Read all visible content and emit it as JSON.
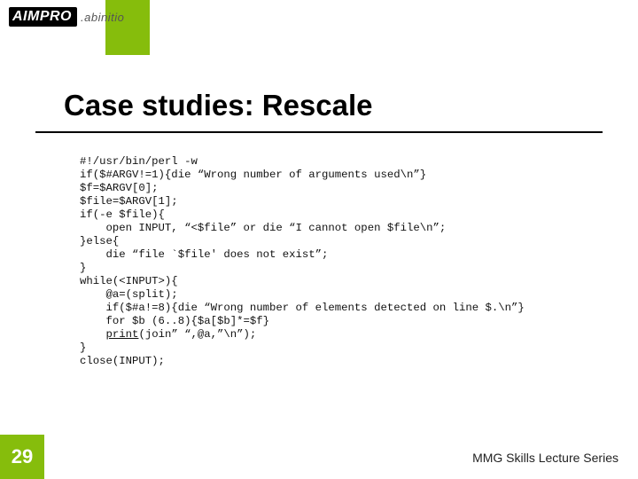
{
  "logo": {
    "main": "AIMPRO",
    "sub": ".abinitio"
  },
  "title": "Case studies: Rescale",
  "code": {
    "l1": "#!/usr/bin/perl -w",
    "l2": "if($#ARGV!=1){die “Wrong number of arguments used\\n”}",
    "l3": "$f=$ARGV[0];",
    "l4": "$file=$ARGV[1];",
    "l5": "if(-e $file){",
    "l6": "    open INPUT, “<$file” or die “I cannot open $file\\n”;",
    "l7": "}else{",
    "l8": "    die “file `$file' does not exist”;",
    "l9": "}",
    "l10": "while(<INPUT>){",
    "l11": "    @a=(split);",
    "l12": "    if($#a!=8){die “Wrong number of elements detected on line $.\\n”}",
    "l13": "    for $b (6..8){$a[$b]*=$f}",
    "l14a": "    ",
    "l14b": "print",
    "l14c": "(join” “,@a,”\\n”);",
    "l15": "}",
    "l16": "close(INPUT);"
  },
  "page_number": "29",
  "footer": "MMG Skills Lecture Series"
}
